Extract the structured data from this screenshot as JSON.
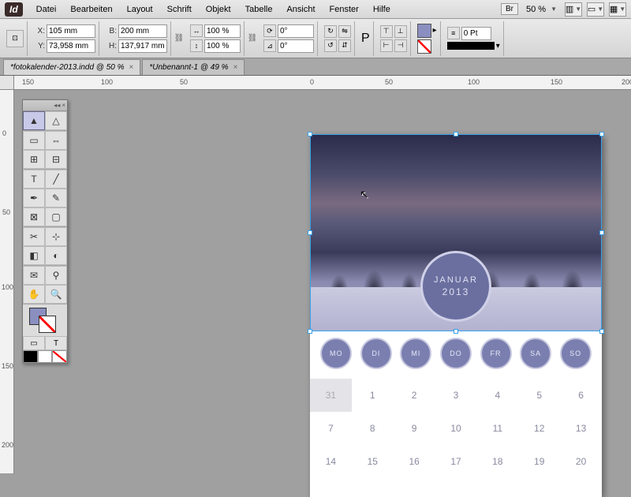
{
  "app": {
    "logo": "Id"
  },
  "menu": {
    "items": [
      "Datei",
      "Bearbeiten",
      "Layout",
      "Schrift",
      "Objekt",
      "Tabelle",
      "Ansicht",
      "Fenster",
      "Hilfe"
    ],
    "br_label": "Br",
    "zoom": "50 %"
  },
  "control": {
    "x_label": "X:",
    "x_value": "105 mm",
    "y_label": "Y:",
    "y_value": "73,958 mm",
    "w_label": "B:",
    "w_value": "200 mm",
    "h_label": "H:",
    "h_value": "137,917 mm",
    "scale_x": "100 %",
    "scale_y": "100 %",
    "rotate": "0°",
    "shear": "0°",
    "stroke_pt": "0 Pt"
  },
  "tabs": [
    {
      "label": "*fotokalender-2013.indd @ 50 %",
      "active": true
    },
    {
      "label": "*Unbenannt-1 @ 49 %",
      "active": false
    }
  ],
  "hruler_marks": [
    "150",
    "100",
    "50",
    "0",
    "50",
    "100",
    "150",
    "200"
  ],
  "vruler_marks": [
    "0",
    "50",
    "100",
    "150",
    "200"
  ],
  "calendar": {
    "month": "JANUAR",
    "year": "2013",
    "weekdays": [
      "MO",
      "DI",
      "MI",
      "DO",
      "FR",
      "SA",
      "SO"
    ],
    "rows": [
      [
        "31",
        "1",
        "2",
        "3",
        "4",
        "5",
        "6"
      ],
      [
        "7",
        "8",
        "9",
        "10",
        "11",
        "12",
        "13"
      ],
      [
        "14",
        "15",
        "16",
        "17",
        "18",
        "19",
        "20"
      ]
    ],
    "prev_cells": [
      0
    ]
  },
  "tools": [
    [
      "selection",
      "direct-selection"
    ],
    [
      "page",
      "gap"
    ],
    [
      "content-collector",
      "content-placer"
    ],
    [
      "type",
      "line"
    ],
    [
      "pen",
      "pencil"
    ],
    [
      "rectangle-frame",
      "rectangle"
    ],
    [
      "scissors",
      "free-transform"
    ],
    [
      "gradient-swatch",
      "gradient-feather"
    ],
    [
      "note",
      "eyedropper"
    ],
    [
      "hand",
      "zoom"
    ]
  ],
  "tool_glyphs": {
    "selection": "▲",
    "direct-selection": "△",
    "page": "▭",
    "gap": "⇔",
    "content-collector": "⊞",
    "content-placer": "⊟",
    "type": "T",
    "line": "╱",
    "pen": "✒",
    "pencil": "✎",
    "rectangle-frame": "⊠",
    "rectangle": "▢",
    "scissors": "✂",
    "free-transform": "⊹",
    "gradient-swatch": "◧",
    "gradient-feather": "◐",
    "note": "✉",
    "eyedropper": "⚲",
    "hand": "✋",
    "zoom": "🔍"
  }
}
